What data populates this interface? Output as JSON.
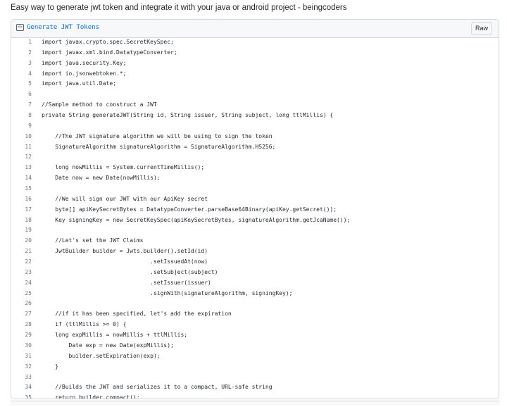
{
  "page": {
    "title": "Easy way to generate jwt token and integrate it with your java or android project - beingcoders"
  },
  "gist": {
    "file_icon": "code-file-icon",
    "file_icon_glyph": "<>",
    "file_name": "Generate JWT Tokens",
    "raw_label": "Raw",
    "lines": [
      "import javax.crypto.spec.SecretKeySpec;",
      "import javax.xml.bind.DatatypeConverter;",
      "import java.security.Key;",
      "import io.jsonwebtoken.*;",
      "import java.util.Date;",
      "",
      "//Sample method to construct a JWT",
      "private String generateJWT(String id, String issuer, String subject, long ttlMillis) {",
      "",
      "    //The JWT signature algorithm we will be using to sign the token",
      "    SignatureAlgorithm signatureAlgorithm = SignatureAlgorithm.HS256;",
      "",
      "    long nowMillis = System.currentTimeMillis();",
      "    Date now = new Date(nowMillis);",
      "",
      "    //We will sign our JWT with our ApiKey secret",
      "    byte[] apiKeySecretBytes = DatatypeConverter.parseBase64Binary(apiKey.getSecret());",
      "    Key signingKey = new SecretKeySpec(apiKeySecretBytes, signatureAlgorithm.getJcaName());",
      "",
      "    //Let's set the JWT Claims",
      "    JwtBuilder builder = Jwts.builder().setId(id)",
      "                                .setIssuedAt(now)",
      "                                .setSubject(subject)",
      "                                .setIssuer(issuer)",
      "                                .signWith(signatureAlgorithm, signingKey);",
      "",
      "    //if it has been specified, let's add the expiration",
      "    if (ttlMillis >= 0) {",
      "    long expMillis = nowMillis + ttlMillis;",
      "        Date exp = new Date(expMillis);",
      "        builder.setExpiration(exp);",
      "    }",
      "",
      "    //Builds the JWT and serializes it to a compact, URL-safe string",
      "    return builder.compact();",
      "}"
    ]
  }
}
